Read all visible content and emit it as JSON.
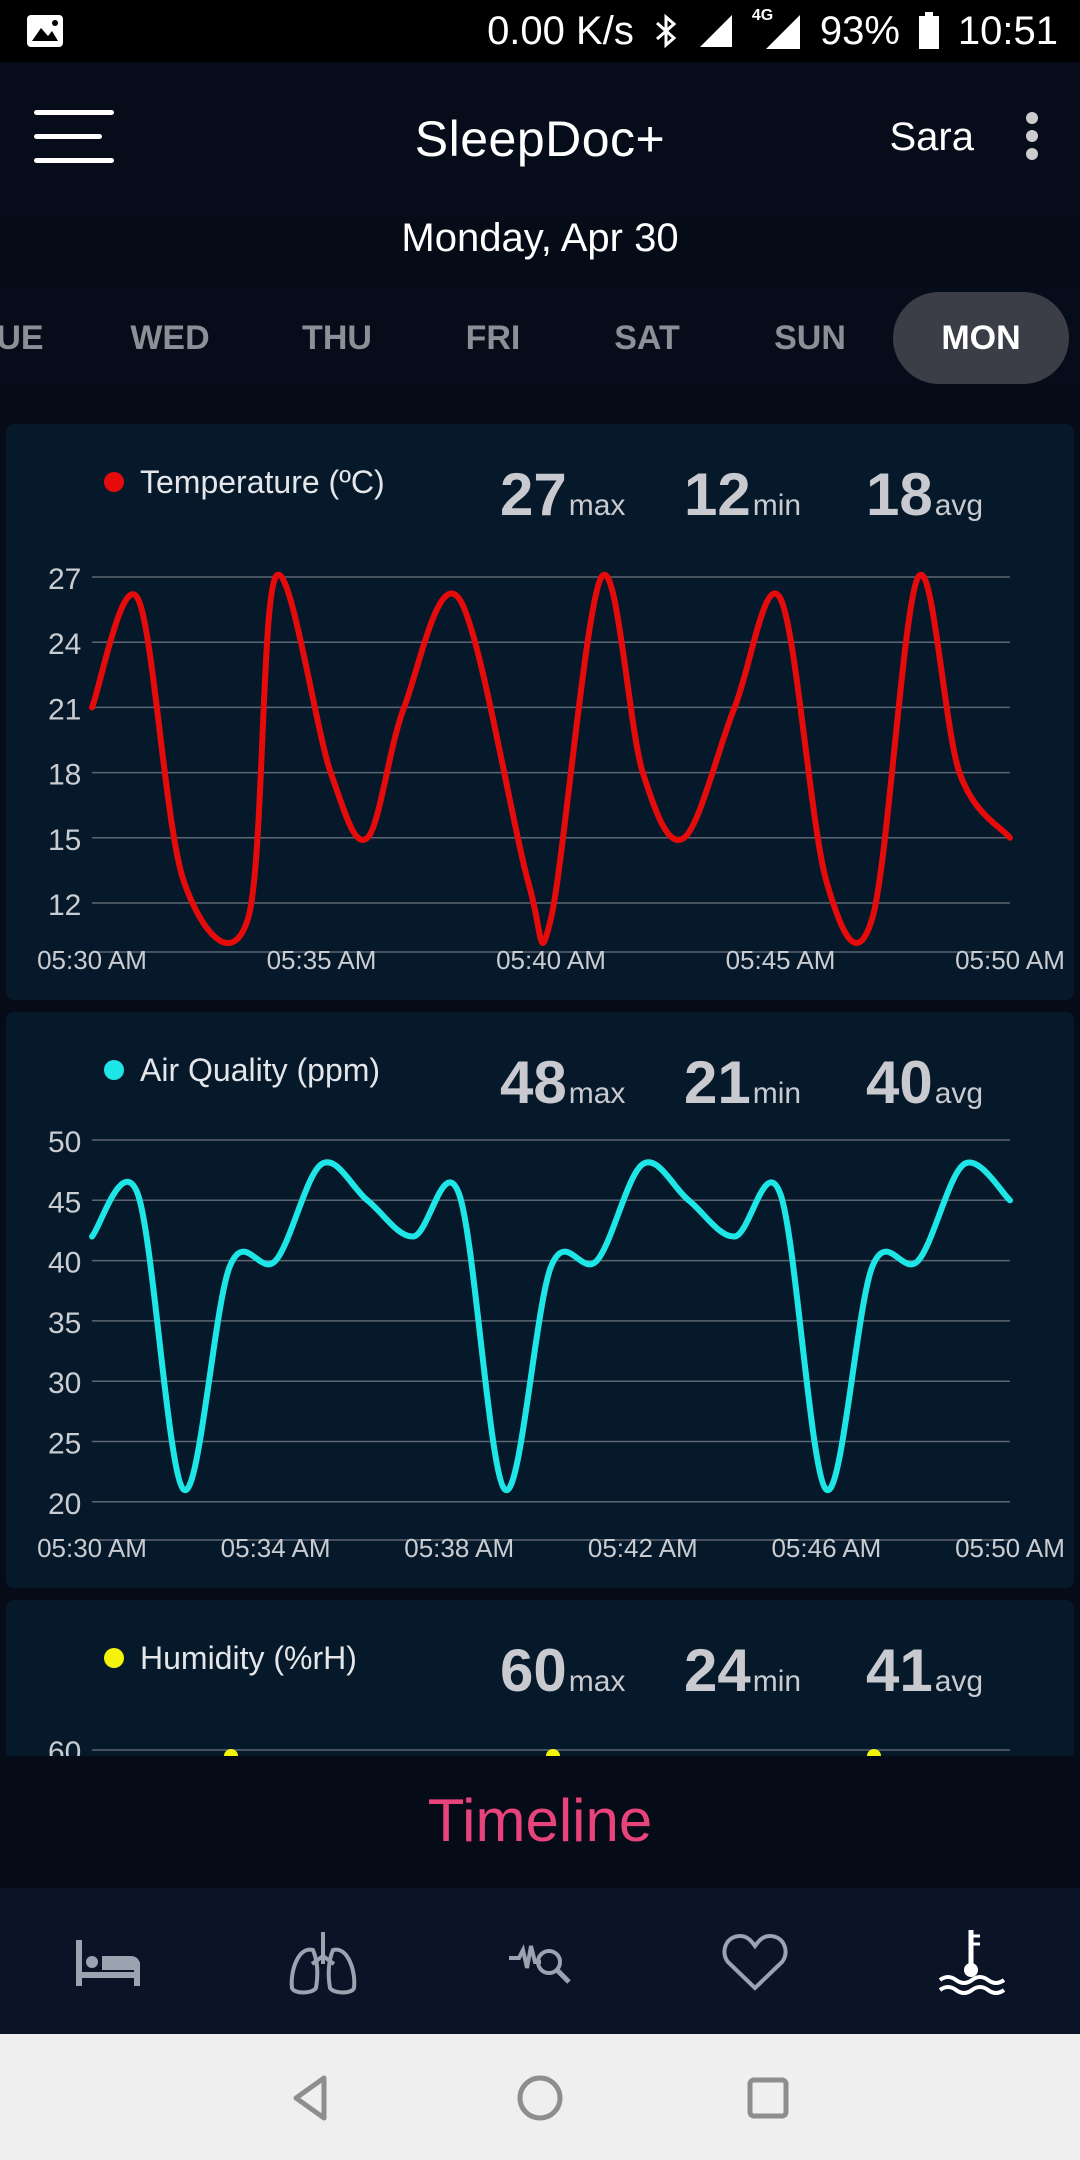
{
  "status_bar": {
    "speed": "0.00 K/s",
    "network": "4G",
    "battery": "93%",
    "time": "10:51"
  },
  "app": {
    "title": "SleepDoc+",
    "user": "Sara",
    "date": "Monday, Apr 30"
  },
  "days": [
    {
      "label": "UE"
    },
    {
      "label": "WED"
    },
    {
      "label": "THU"
    },
    {
      "label": "FRI"
    },
    {
      "label": "SAT"
    },
    {
      "label": "SUN"
    },
    {
      "label": "MON",
      "active": true
    }
  ],
  "cards": {
    "temperature": {
      "title": "Temperature (ºC)",
      "max": "27",
      "max_label": "max",
      "min": "12",
      "min_label": "min",
      "avg": "18",
      "avg_label": "avg",
      "color": "#e60b0b"
    },
    "air": {
      "title": "Air Quality (ppm)",
      "max": "48",
      "max_label": "max",
      "min": "21",
      "min_label": "min",
      "avg": "40",
      "avg_label": "avg",
      "color": "#1ee6e6"
    },
    "humidity": {
      "title": "Humidity (%rH)",
      "max": "60",
      "max_label": "max",
      "min": "24",
      "min_label": "min",
      "avg": "41",
      "avg_label": "avg",
      "color": "#f3f30c"
    }
  },
  "chart_data": [
    {
      "type": "line",
      "title": "Temperature (ºC)",
      "color": "#e60b0b",
      "y_ticks": [
        "27",
        "24",
        "21",
        "18",
        "15",
        "12"
      ],
      "x_ticks": [
        "05:30 AM",
        "05:35 AM",
        "05:40 AM",
        "05:45 AM",
        "05:50 AM"
      ],
      "ylim": [
        11,
        27.5
      ],
      "xlim": [
        0,
        20
      ],
      "x": [
        0,
        1,
        2,
        3.4,
        4,
        5.2,
        6,
        6.8,
        8,
        9.5,
        10,
        11.1,
        12,
        12.9,
        14,
        15,
        16,
        17,
        18,
        18.9,
        20
      ],
      "y": [
        21,
        26,
        13,
        11.3,
        27,
        18,
        15,
        21,
        26,
        13,
        11.3,
        27,
        18,
        15,
        21,
        26,
        13,
        11.3,
        27,
        18,
        15
      ],
      "grid": true
    },
    {
      "type": "line",
      "title": "Air Quality (ppm)",
      "color": "#1ee6e6",
      "y_ticks": [
        "50",
        "45",
        "40",
        "35",
        "30",
        "25",
        "20"
      ],
      "x_ticks": [
        "05:30 AM",
        "05:34 AM",
        "05:38 AM",
        "05:42 AM",
        "05:46 AM",
        "05:50 AM"
      ],
      "ylim": [
        20,
        50
      ],
      "xlim": [
        0,
        20
      ],
      "x": [
        0,
        1,
        2,
        3,
        4,
        5,
        6,
        7,
        8,
        9,
        10,
        11,
        12,
        13,
        14,
        15,
        16,
        17,
        18,
        19,
        20
      ],
      "y": [
        42,
        45.5,
        21,
        39.5,
        40,
        48,
        45,
        42,
        45.5,
        21,
        39.5,
        40,
        48,
        45,
        42,
        45.5,
        21,
        39.5,
        40,
        48,
        45
      ],
      "grid": true
    },
    {
      "type": "line",
      "title": "Humidity (%rH)",
      "color": "#f3f30c",
      "y_ticks": [
        "60"
      ],
      "grid": true
    }
  ],
  "timeline": "Timeline",
  "nav_icons": [
    "bed-icon",
    "lungs-icon",
    "heart-rate-search-icon",
    "heart-icon",
    "temperature-water-icon"
  ],
  "system_nav": [
    "back-icon",
    "home-icon",
    "recents-icon"
  ]
}
